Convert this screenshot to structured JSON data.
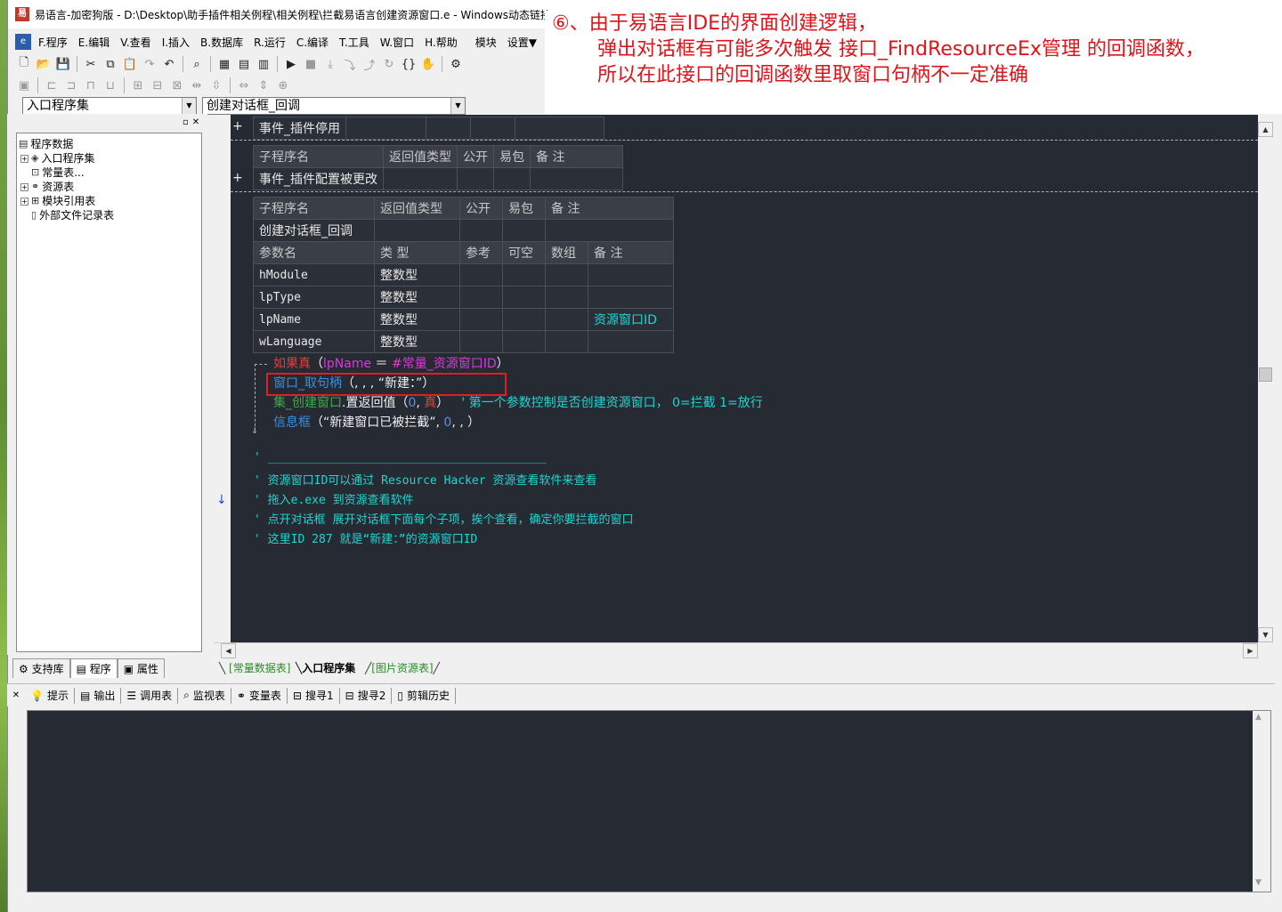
{
  "window": {
    "title": "易语言-加密狗版 - D:\\Desktop\\助手插件相关例程\\相关例程\\拦截易语言创建资源窗口.e - Windows动态链接"
  },
  "annotation": {
    "line1": "⑥、由于易语言IDE的界面创建逻辑，",
    "line2": "弹出对话框有可能多次触发 接口_FindResourceEx管理 的回调函数，",
    "line3": "所以在此接口的回调函数里取窗口句柄不一定准确",
    "color": "#e0121a"
  },
  "menu": [
    {
      "label": "F.程序"
    },
    {
      "label": "E.编辑"
    },
    {
      "label": "V.查看"
    },
    {
      "label": "I.插入"
    },
    {
      "label": "B.数据库"
    },
    {
      "label": "R.运行"
    },
    {
      "label": "C.编译"
    },
    {
      "label": "T.工具"
    },
    {
      "label": "W.窗口"
    },
    {
      "label": "H.帮助"
    },
    {
      "label": "模块"
    },
    {
      "label": "设置▼"
    }
  ],
  "combos": {
    "left": "入口程序集",
    "right": "创建对话框_回调"
  },
  "tree": {
    "root": "程序数据",
    "items": [
      {
        "label": "入口程序集",
        "exp": "+"
      },
      {
        "label": "常量表...",
        "exp": ""
      },
      {
        "label": "资源表",
        "exp": "+"
      },
      {
        "label": "模块引用表",
        "exp": "+"
      },
      {
        "label": "外部文件记录表",
        "exp": ""
      }
    ]
  },
  "left_tabs": [
    {
      "label": "支持库"
    },
    {
      "label": "程序"
    },
    {
      "label": "属性"
    }
  ],
  "code": {
    "row_plugin_stop": "事件_插件停用",
    "table1": {
      "headers": [
        "子程序名",
        "返回值类型",
        "公开",
        "易包",
        "备 注"
      ],
      "name": "事件_插件配置被更改"
    },
    "table2": {
      "headers": [
        "子程序名",
        "返回值类型",
        "公开",
        "易包",
        "备 注"
      ],
      "name": "创建对话框_回调",
      "param_headers": [
        "参数名",
        "类 型",
        "参考",
        "可空",
        "数组",
        "备 注"
      ],
      "params": [
        {
          "name": "hModule",
          "type": "整数型",
          "note": ""
        },
        {
          "name": "lpType",
          "type": "整数型",
          "note": ""
        },
        {
          "name": "lpName",
          "type": "整数型",
          "note": "资源窗口ID"
        },
        {
          "name": "wLanguage",
          "type": "整数型",
          "note": ""
        }
      ]
    },
    "lines": {
      "if_kw": "如果真",
      "if_open": "（",
      "if_var": "lpName",
      "if_eq": " ＝ ",
      "if_const": "#常量_资源窗口ID",
      "if_close": "）",
      "l2_fn": "窗口_取句柄",
      "l2_args": "（, , , “新建：”）",
      "l3_obj": "集_创建窗口",
      "l3_method": ".置返回值",
      "l3_open": "（",
      "l3_zero": "0",
      "l3_sep": ", ",
      "l3_true": "真",
      "l3_close": "）",
      "l3_comment": "'  第一个参数控制是否创建资源窗口，   0=拦截  1=放行",
      "l4_fn": "信息框",
      "l4_open": "（",
      "l4_str": "“新建窗口已被拦截”",
      "l4_sep": ", ",
      "l4_zero": "0",
      "l4_close": ", , ）",
      "c0": "' ________________________________________",
      "c1": "' 资源窗口ID可以通过 Resource Hacker 资源查看软件来查看",
      "c2": "' 拖入e.exe 到资源查看软件",
      "c3": "' 点开对话框  展开对话框下面每个子项，挨个查看，确定你要拦截的窗口",
      "c4": "' 这里ID 287 就是“新建：”的资源窗口ID"
    }
  },
  "bottom_tabs": [
    {
      "label": "[常量数据表]"
    },
    {
      "label": "入口程序集"
    },
    {
      "label": "[图片资源表]"
    }
  ],
  "output_tabs": [
    {
      "label": "提示",
      "icon": "hint-icon"
    },
    {
      "label": "输出",
      "icon": "output-icon"
    },
    {
      "label": "调用表",
      "icon": "calltable-icon"
    },
    {
      "label": "监视表",
      "icon": "watch-icon"
    },
    {
      "label": "变量表",
      "icon": "vars-icon"
    },
    {
      "label": "搜寻1",
      "icon": "search1-icon"
    },
    {
      "label": "搜寻2",
      "icon": "search2-icon"
    },
    {
      "label": "剪辑历史",
      "icon": "clip-icon"
    }
  ]
}
